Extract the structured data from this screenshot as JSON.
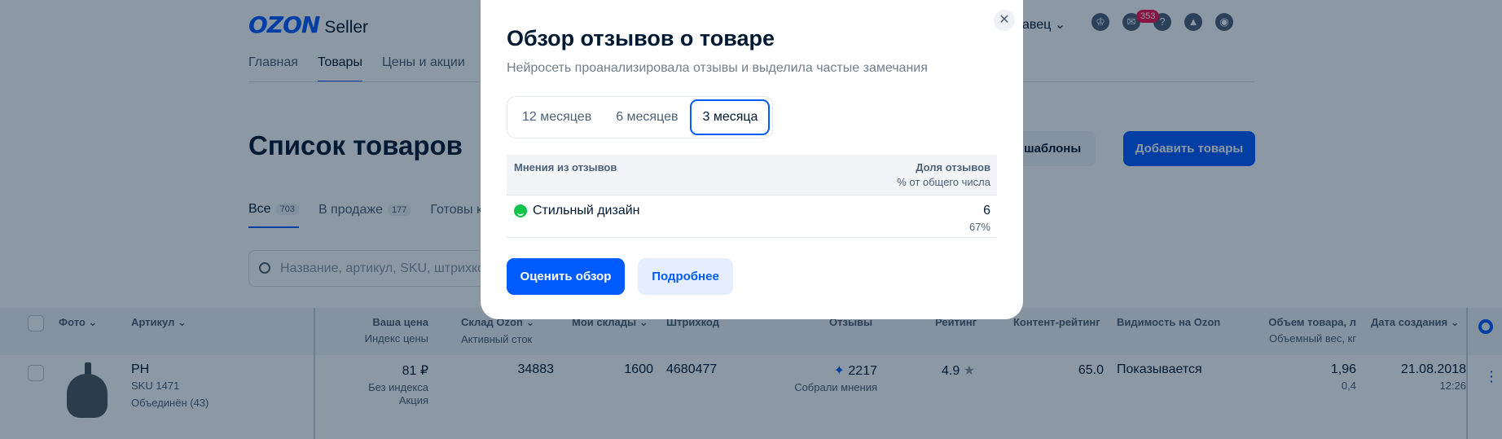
{
  "header": {
    "logo_brand": "OZON",
    "logo_product": "Seller",
    "seller_name": "авец",
    "chat_badge": "353",
    "nav": [
      "Главная",
      "Товары",
      "Цены и акции"
    ]
  },
  "page": {
    "title": "Список товаров",
    "templates_button": "ать шаблоны",
    "add_button": "Добавить товары",
    "tabs": [
      {
        "label": "Все",
        "count": "703"
      },
      {
        "label": "В продаже",
        "count": "177"
      },
      {
        "label": "Готовы к",
        "count": ""
      }
    ],
    "search_placeholder": "Название, артикул, SKU, штрихко"
  },
  "table": {
    "headers": {
      "photo": "Фото",
      "article": "Артикул",
      "price": "Ваша цена",
      "price_sub": "Индекс цены",
      "warehouse_ozon": "Склад Ozon",
      "warehouse_ozon_sub": "Активный сток",
      "my_warehouses": "Мои склады",
      "barcode": "Штрихкод",
      "reviews": "Отзывы",
      "rating": "Рейтинг",
      "content_rating": "Контент-рейтинг",
      "visibility": "Видимость на Ozon",
      "volume": "Объем товара, л",
      "volume_sub": "Объемный вес, кг",
      "created": "Дата создания"
    },
    "row": {
      "article": "PH",
      "sku": "SKU 1471",
      "merged": "Объединён (43)",
      "price": "81 ₽",
      "price_index": "Без индекса",
      "promo": "Акция",
      "warehouse_ozon": "34883",
      "my_warehouses": "1600",
      "barcode": "4680477",
      "reviews": "2217",
      "reviews_sub": "Собрали мнения",
      "rating": "4.9",
      "content_rating": "65.0",
      "visibility": "Показывается",
      "volume": "1,96",
      "volume_weight": "0,4",
      "created_date": "21.08.2018",
      "created_time": "12:26"
    }
  },
  "modal": {
    "title": "Обзор отзывов о товаре",
    "subtitle": "Нейросеть проанализировала отзывы и выделила частые замечания",
    "periods": [
      "12 месяцев",
      "6 месяцев",
      "3 месяца"
    ],
    "selected_period": "3 месяца",
    "table": {
      "col_opinions": "Мнения из отзывов",
      "col_share": "Доля отзывов",
      "col_share_sub": "% от общего числа",
      "rows": [
        {
          "label": "Стильный дизайн",
          "count": "6",
          "percent": "67%"
        }
      ]
    },
    "rate_button": "Оценить обзор",
    "more_button": "Подробнее"
  },
  "colors": {
    "accent": "#005bff",
    "overlay": "#001a34",
    "positive": "#10c44c",
    "badge": "#f91155"
  }
}
